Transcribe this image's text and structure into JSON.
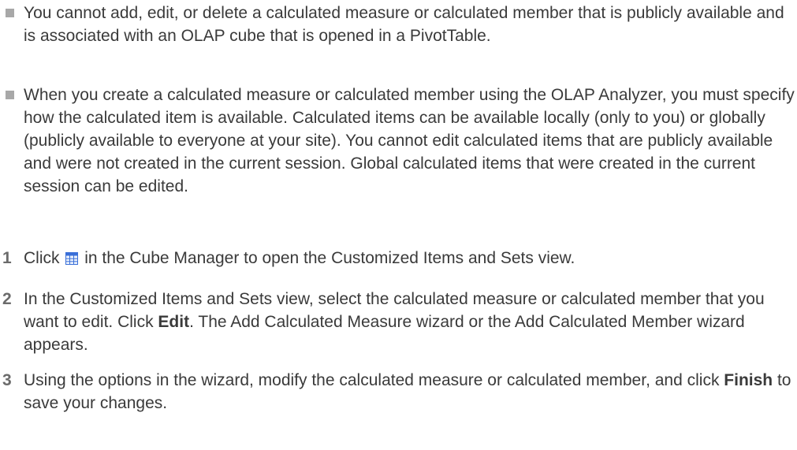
{
  "bullets": [
    {
      "text": "You cannot add, edit, or delete a calculated measure or calculated member that is publicly available and is associated with an OLAP cube that is opened in a PivotTable."
    },
    {
      "text": "When you create a calculated measure or calculated member using the OLAP Analyzer, you must specify how the calculated item is available. Calculated items can be available locally (only to you) or globally (publicly available to everyone at your site). You cannot edit calculated items that are publicly available and were not created in the current session. Global calculated items that were created in the current session can be edited."
    }
  ],
  "steps": [
    {
      "num": "1",
      "before": "Click",
      "icon": "customized-items-sets-icon",
      "after": "in the Cube Manager to open the Customized Items and Sets view."
    },
    {
      "num": "2",
      "before": "In the Customized Items and Sets view, select the calculated measure or calculated member that you want to edit. Click ",
      "bold": "Edit",
      "after": ". The Add Calculated Measure wizard or the Add Calculated Member wizard appears."
    },
    {
      "num": "3",
      "before": "Using the options in the wizard, modify the calculated measure or calculated member, and click ",
      "bold": "Finish",
      "after": " to save your changes."
    }
  ],
  "colors": {
    "text": "#3a3a3a",
    "bullet": "#a8a8a8",
    "step_number": "#6b6b6b",
    "icon_blue": "#3a6fd8"
  }
}
